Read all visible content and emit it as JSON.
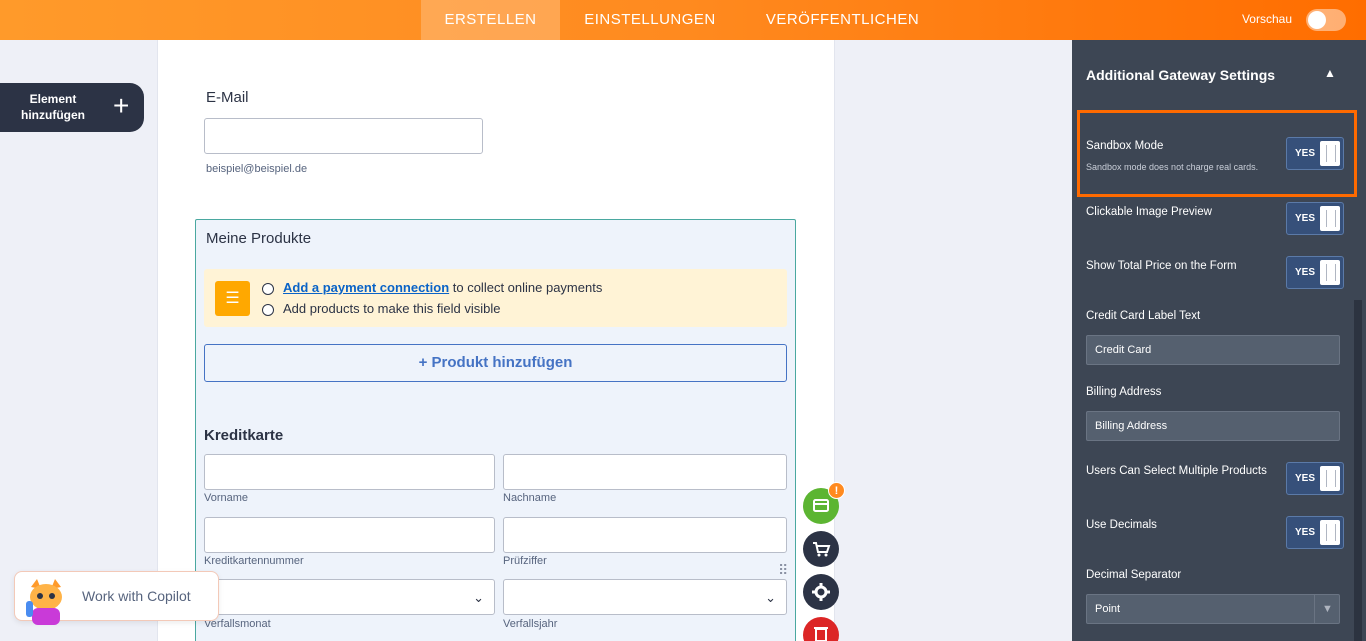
{
  "topbar": {
    "tabs": [
      {
        "label": "ERSTELLEN",
        "active": true
      },
      {
        "label": "EINSTELLUNGEN",
        "active": false
      },
      {
        "label": "VERÖFFENTLICHEN",
        "active": false
      }
    ],
    "preview_label": "Vorschau",
    "preview_on": false
  },
  "sidebar": {
    "add_element_label": "Element hinzufügen",
    "add_icon": "plus-icon"
  },
  "form": {
    "email_label": "E-Mail",
    "email_value": "",
    "email_sublabel": "beispiel@beispiel.de",
    "products": {
      "title": "Meine Produkte",
      "notice_icon": "checklist-icon",
      "notice_link": "Add a payment connection",
      "notice_line1_rest": " to collect online payments",
      "notice_line2": "Add products to make this field visible",
      "add_product_label": "+ Produkt hinzufügen"
    },
    "credit_card": {
      "heading": "Kreditkarte",
      "first_name": "Vorname",
      "last_name": "Nachname",
      "card_number": "Kreditkartennummer",
      "cvv": "Prüfziffer",
      "exp_month": "Verfallsmonat",
      "exp_year": "Verfallsjahr"
    }
  },
  "fabs": {
    "payment_badge": "!",
    "payment_color": "#5cb532",
    "dark_color": "#2c3345",
    "delete_color": "#dc2626"
  },
  "copilot": {
    "label": "Work with Copilot"
  },
  "panel": {
    "title": "Additional Gateway Settings",
    "options": [
      {
        "label": "Sandbox Mode",
        "sub": "Sandbox mode does not charge real cards.",
        "toggle": "YES"
      },
      {
        "label": "Clickable Image Preview",
        "toggle": "YES"
      },
      {
        "label": "Show Total Price on the Form",
        "toggle": "YES"
      }
    ],
    "credit_card_label_title": "Credit Card Label Text",
    "credit_card_label_value": "Credit Card",
    "billing_title": "Billing Address",
    "billing_value": "Billing Address",
    "multi_products": {
      "label": "Users Can Select Multiple Products",
      "toggle": "YES"
    },
    "decimals": {
      "label": "Use Decimals",
      "toggle": "YES"
    },
    "decimal_sep_title": "Decimal Separator",
    "decimal_sep_value": "Point"
  }
}
